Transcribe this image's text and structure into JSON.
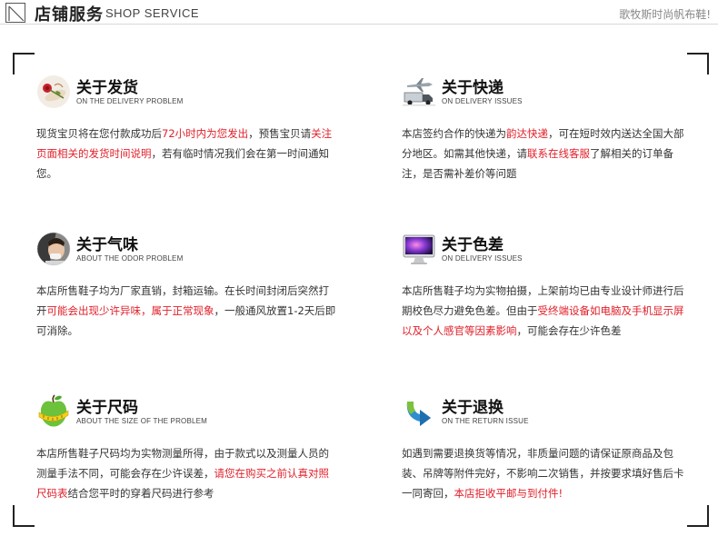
{
  "header": {
    "title_cn": "店铺服务",
    "title_en": "SHOP SERVICE",
    "brand": "歌牧斯时尚帆布鞋!"
  },
  "sections": [
    {
      "icon": "gift-rose-icon",
      "title": "关于发货",
      "subtitle": "ON THE DELIVERY PROBLEM",
      "body": [
        {
          "t": "现货宝贝将在您付款成功后"
        },
        {
          "t": "72小时内为您发出",
          "red": true
        },
        {
          "t": "，预售宝贝请"
        },
        {
          "t": "关注页面相关的发货时间说明",
          "red": true
        },
        {
          "t": "，若有临时情况我们会在第一时间通知您。"
        }
      ]
    },
    {
      "icon": "delivery-plane-truck-icon",
      "title": "关于快递",
      "subtitle": "ON DELIVERY ISSUES",
      "body": [
        {
          "t": "本店签约合作的快递为"
        },
        {
          "t": "韵达快递",
          "red": true
        },
        {
          "t": "，可在短时效内送达全国大部分地区。如需其他快递，请"
        },
        {
          "t": "联系在线客服",
          "red": true
        },
        {
          "t": "了解相关的订单备注，是否需补差价等问题"
        }
      ]
    },
    {
      "icon": "person-smell-icon",
      "title": "关于气味",
      "subtitle": "ABOUT THE ODOR PROBLEM",
      "body": [
        {
          "t": "本店所售鞋子均为厂家直销，封箱运输。在长时间封闭后突然打开"
        },
        {
          "t": "可能会出现少许异味，属于正常现象",
          "red": true
        },
        {
          "t": "，一般通风放置1-2天后即可消除。"
        }
      ]
    },
    {
      "icon": "computer-monitor-icon",
      "title": "关于色差",
      "subtitle": "ON DELIVERY ISSUES",
      "body": [
        {
          "t": "本店所售鞋子均为实物拍摄，上架前均已由专业设计师进行后期校色尽力避免色差。但由于"
        },
        {
          "t": "受终端设备如电脑及手机显示屏以及个人感官等因素影响",
          "red": true
        },
        {
          "t": "，可能会存在少许色差"
        }
      ]
    },
    {
      "icon": "apple-tape-measure-icon",
      "title": "关于尺码",
      "subtitle": "ABOUT THE SIZE OF THE PROBLEM",
      "body": [
        {
          "t": "本店所售鞋子尺码均为实物测量所得，由于款式以及测量人员的测量手法不同，可能会存在少许误差，"
        },
        {
          "t": "请您在购买之前认真对照尺码表",
          "red": true
        },
        {
          "t": "结合您平时的穿着尺码进行参考"
        }
      ]
    },
    {
      "icon": "return-arrow-icon",
      "title": "关于退换",
      "subtitle": "ON THE RETURN ISSUE",
      "body": [
        {
          "t": "如遇到需要退换货等情况，非质量问题的请保证原商品及包装、吊牌等附件完好，不影响二次销售，并按要求填好售后卡一同寄回，"
        },
        {
          "t": "本店拒收平邮与到付件!",
          "red": true
        }
      ]
    }
  ]
}
